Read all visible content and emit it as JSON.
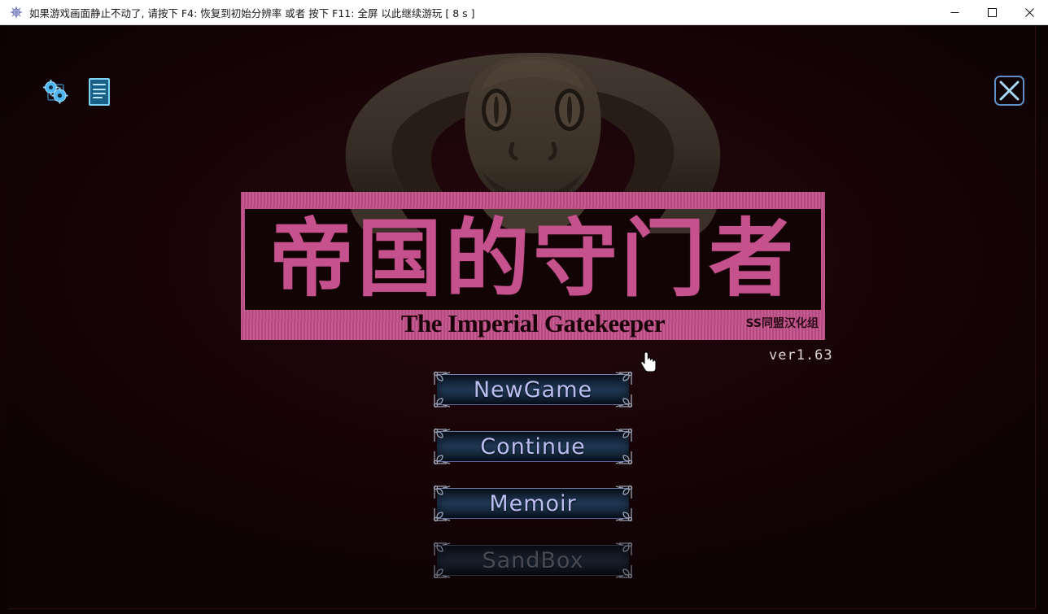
{
  "window": {
    "icon": "snowflake-icon",
    "title": "如果游戏画面静止不动了, 请按下 F4: 恢复到初始分辨率 或者 按下 F11: 全屏 以此继续游玩 [ 8 s ]",
    "controls": {
      "minimize": "—",
      "maximize": "▢",
      "close": "✕"
    }
  },
  "game": {
    "tool_icons": [
      {
        "name": "settings-gears-icon",
        "label": "Settings"
      },
      {
        "name": "document-list-icon",
        "label": "Log"
      }
    ],
    "close_button": {
      "name": "close-icon",
      "label": "✕"
    },
    "logo": {
      "title_cn": "帝国的守门者",
      "title_en": "The Imperial Gatekeeper",
      "credit": "SS同盟汉化组",
      "frame_color": "#c5528c",
      "inner_color": "#120305"
    },
    "version": "ver1.63",
    "cursor": "pointing-hand-cursor",
    "menu": [
      {
        "id": "new-game",
        "label": "NewGame",
        "disabled": false
      },
      {
        "id": "continue",
        "label": "Continue",
        "disabled": false
      },
      {
        "id": "memoir",
        "label": "Memoir",
        "disabled": false
      },
      {
        "id": "sandbox",
        "label": "SandBox",
        "disabled": true
      }
    ],
    "colors": {
      "background": "#1a0408",
      "accent_pink": "#c5528c",
      "menu_text": "#b9bdf0",
      "menu_text_disabled": "#4a4a55",
      "icon_blue": "#6fc3f2",
      "snake_body": "#3d3129"
    }
  }
}
